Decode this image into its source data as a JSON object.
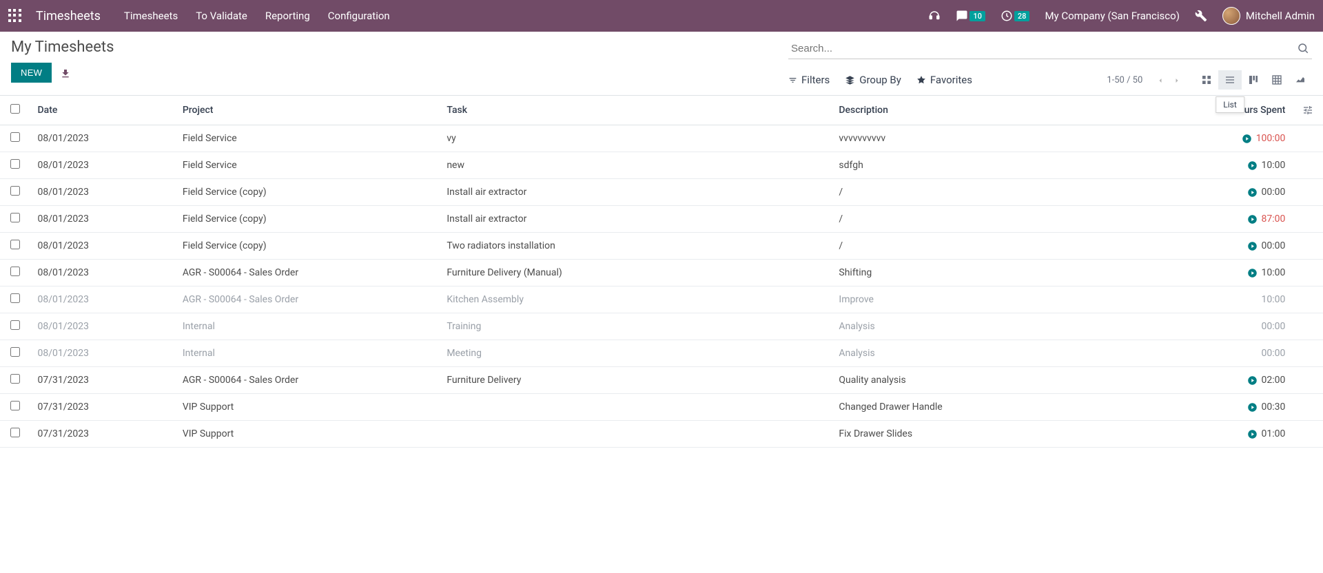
{
  "topbar": {
    "app_title": "Timesheets",
    "nav": [
      "Timesheets",
      "To Validate",
      "Reporting",
      "Configuration"
    ],
    "messages_count": "10",
    "activities_count": "28",
    "company": "My Company (San Francisco)",
    "user": "Mitchell Admin"
  },
  "header": {
    "title": "My Timesheets",
    "new_btn": "NEW",
    "search_placeholder": "Search...",
    "filters": "Filters",
    "group_by": "Group By",
    "favorites": "Favorites",
    "pager": "1-50 / 50",
    "list_tooltip": "List"
  },
  "columns": {
    "date": "Date",
    "project": "Project",
    "task": "Task",
    "description": "Description",
    "hours": "Hours Spent"
  },
  "rows": [
    {
      "date": "08/01/2023",
      "project": "Field Service",
      "task": "vy",
      "description": "vvvvvvvvvv",
      "hours": "100:00",
      "play": true,
      "orange": true,
      "muted": false
    },
    {
      "date": "08/01/2023",
      "project": "Field Service",
      "task": "new",
      "description": "sdfgh",
      "hours": "10:00",
      "play": true,
      "orange": false,
      "muted": false
    },
    {
      "date": "08/01/2023",
      "project": "Field Service (copy)",
      "task": "Install air extractor",
      "description": "/",
      "hours": "00:00",
      "play": true,
      "orange": false,
      "muted": false
    },
    {
      "date": "08/01/2023",
      "project": "Field Service (copy)",
      "task": "Install air extractor",
      "description": "/",
      "hours": "87:00",
      "play": true,
      "orange": true,
      "muted": false
    },
    {
      "date": "08/01/2023",
      "project": "Field Service (copy)",
      "task": "Two radiators installation",
      "description": "/",
      "hours": "00:00",
      "play": true,
      "orange": false,
      "muted": false
    },
    {
      "date": "08/01/2023",
      "project": "AGR - S00064 - Sales Order",
      "task": "Furniture Delivery (Manual)",
      "description": "Shifting",
      "hours": "10:00",
      "play": true,
      "orange": false,
      "muted": false
    },
    {
      "date": "08/01/2023",
      "project": "AGR - S00064 - Sales Order",
      "task": "Kitchen Assembly",
      "description": "Improve",
      "hours": "10:00",
      "play": false,
      "orange": false,
      "muted": true
    },
    {
      "date": "08/01/2023",
      "project": "Internal",
      "task": "Training",
      "description": "Analysis",
      "hours": "00:00",
      "play": false,
      "orange": false,
      "muted": true
    },
    {
      "date": "08/01/2023",
      "project": "Internal",
      "task": "Meeting",
      "description": "Analysis",
      "hours": "00:00",
      "play": false,
      "orange": false,
      "muted": true
    },
    {
      "date": "07/31/2023",
      "project": "AGR - S00064 - Sales Order",
      "task": "Furniture Delivery",
      "description": "Quality analysis",
      "hours": "02:00",
      "play": true,
      "orange": false,
      "muted": false
    },
    {
      "date": "07/31/2023",
      "project": "VIP Support",
      "task": "",
      "description": "Changed Drawer Handle",
      "hours": "00:30",
      "play": true,
      "orange": false,
      "muted": false
    },
    {
      "date": "07/31/2023",
      "project": "VIP Support",
      "task": "",
      "description": "Fix Drawer Slides",
      "hours": "01:00",
      "play": true,
      "orange": false,
      "muted": false
    }
  ]
}
